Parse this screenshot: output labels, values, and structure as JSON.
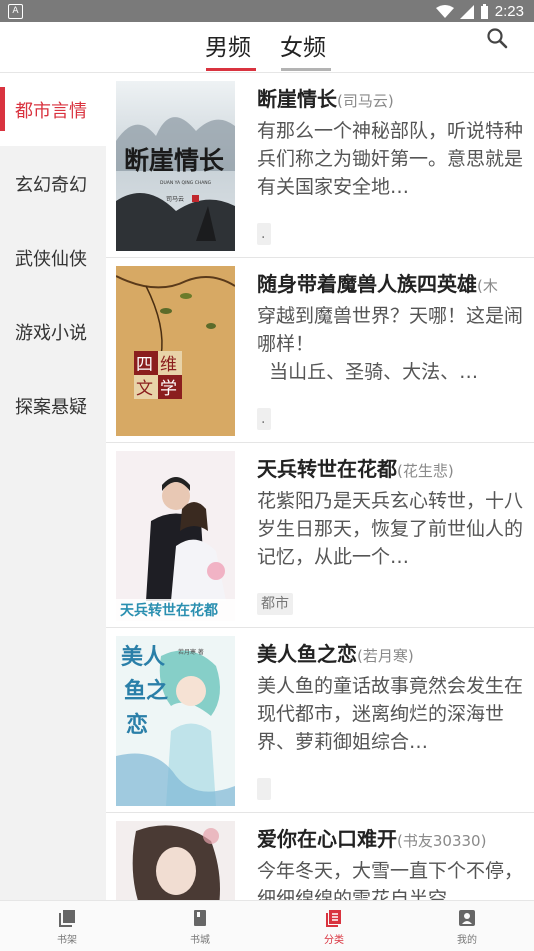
{
  "status": {
    "time": "2:23",
    "badge": "A"
  },
  "header": {
    "tabs": [
      {
        "label": "男频"
      },
      {
        "label": "女频"
      }
    ]
  },
  "sidebar": {
    "items": [
      {
        "label": "都市言情"
      },
      {
        "label": "玄幻奇幻"
      },
      {
        "label": "武侠仙侠"
      },
      {
        "label": "游戏小说"
      },
      {
        "label": "探案悬疑"
      }
    ]
  },
  "books": [
    {
      "title": "断崖情长",
      "author": "(司马云)",
      "desc": "有那么一个神秘部队，听说特种兵们称之为锄奸第一。意思就是有关国家安全地…",
      "tag": ".",
      "cover_text": "断崖情长",
      "cover_sub": "DUAN YA QING CHANG",
      "cover_author": "司马云"
    },
    {
      "title": "随身带着魔兽人族四英雄",
      "author": "(木",
      "desc": "穿越到魔兽世界？天哪！这是闹哪样！\n  当山丘、圣骑、大法、…",
      "tag": ".",
      "cover_text": "四维文学"
    },
    {
      "title": "天兵转世在花都",
      "author": "(花生悲)",
      "desc": "花紫阳乃是天兵玄心转世，十八岁生日那天，恢复了前世仙人的记忆，从此一个…",
      "tag": "都市",
      "cover_text": "天兵转世在花都"
    },
    {
      "title": "美人鱼之恋",
      "author": "(若月寒)",
      "desc": "美人鱼的童话故事竟然会发生在现代都市，迷离绚烂的深海世界、萝莉御姐综合…",
      "tag": "",
      "cover_text": "美人鱼之恋",
      "cover_author": "若月寒 著"
    },
    {
      "title": "爱你在心口难开",
      "author": "(书友30330)",
      "desc": "今年冬天，大雪一直下个不停，细细绵绵的雪花自半空…",
      "tag": ""
    }
  ],
  "bottom_nav": [
    {
      "label": "书架",
      "icon": "bookshelf-icon"
    },
    {
      "label": "书城",
      "icon": "book-icon"
    },
    {
      "label": "分类",
      "icon": "category-icon"
    },
    {
      "label": "我的",
      "icon": "profile-icon"
    }
  ],
  "colors": {
    "accent": "#d9333f",
    "statusbar": "#7a7a7a",
    "sidebar_bg": "#f2f2f2"
  }
}
